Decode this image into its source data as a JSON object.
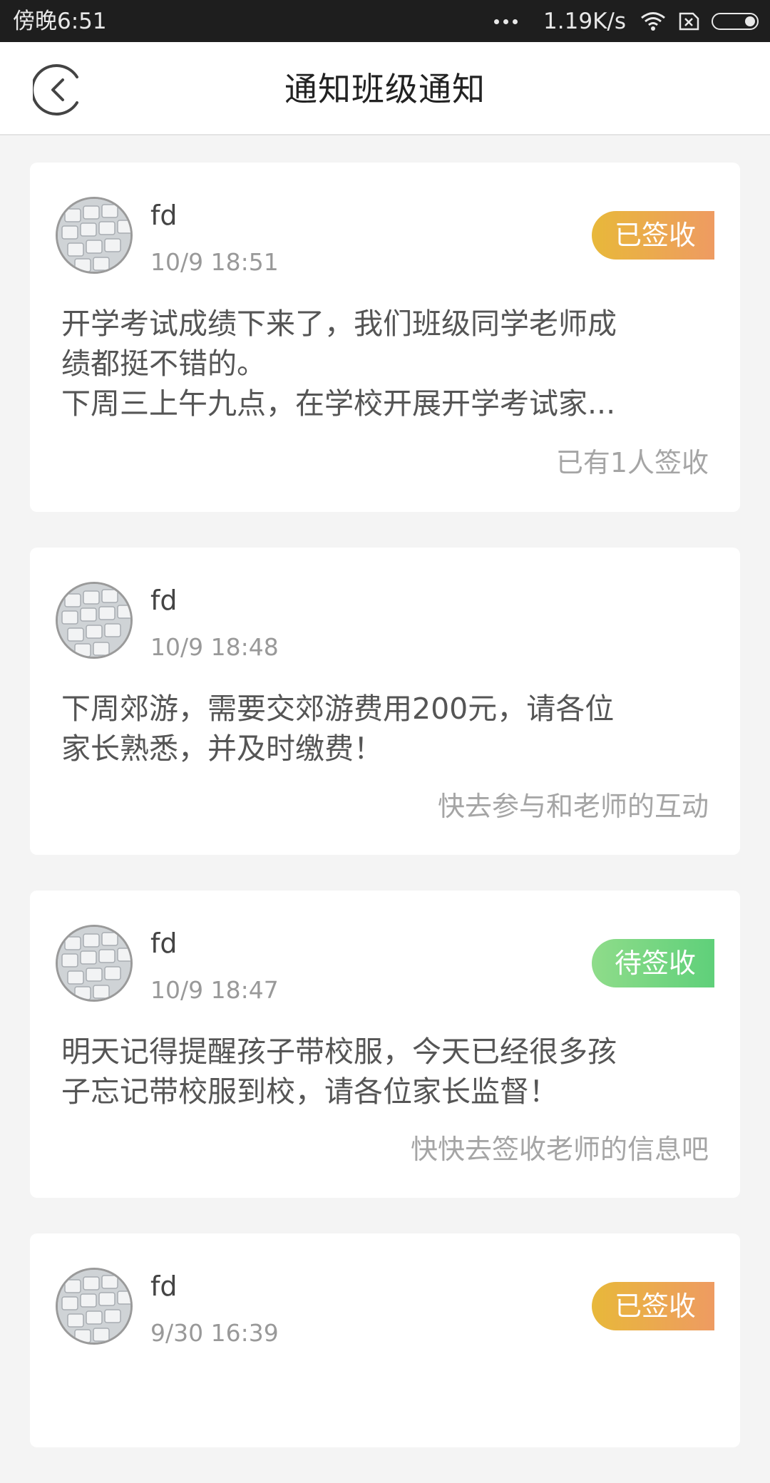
{
  "status_bar": {
    "time": "傍晚6:51",
    "network_speed": "1.19K/s",
    "icons": [
      "more-dots-icon",
      "wifi-icon",
      "sim-x-icon",
      "battery-icon"
    ]
  },
  "header": {
    "title": "通知班级通知",
    "back_icon": "back-arrow-icon"
  },
  "colors": {
    "signed_badge": "#e8b83a",
    "pending_badge": "#5fd07a",
    "background": "#f4f4f4"
  },
  "notices": [
    {
      "author": "fd",
      "time": "10/9 18:51",
      "badge": "已签收",
      "badge_state": "signed",
      "content": "开学考试成绩下来了，我们班级同学老师成\n绩都挺不错的。\n下周三上午九点，在学校开展开学考试家...",
      "footer": "已有1人签收"
    },
    {
      "author": "fd",
      "time": "10/9 18:48",
      "badge": "",
      "badge_state": "none",
      "content": "下周郊游，需要交郊游费用200元，请各位\n家长熟悉，并及时缴费！",
      "footer": "快去参与和老师的互动"
    },
    {
      "author": "fd",
      "time": "10/9 18:47",
      "badge": "待签收",
      "badge_state": "pending",
      "content": "明天记得提醒孩子带校服，今天已经很多孩\n子忘记带校服到校，请各位家长监督！",
      "footer": "快快去签收老师的信息吧"
    },
    {
      "author": "fd",
      "time": "9/30 16:39",
      "badge": "已签收",
      "badge_state": "signed",
      "content": "",
      "footer": ""
    }
  ]
}
